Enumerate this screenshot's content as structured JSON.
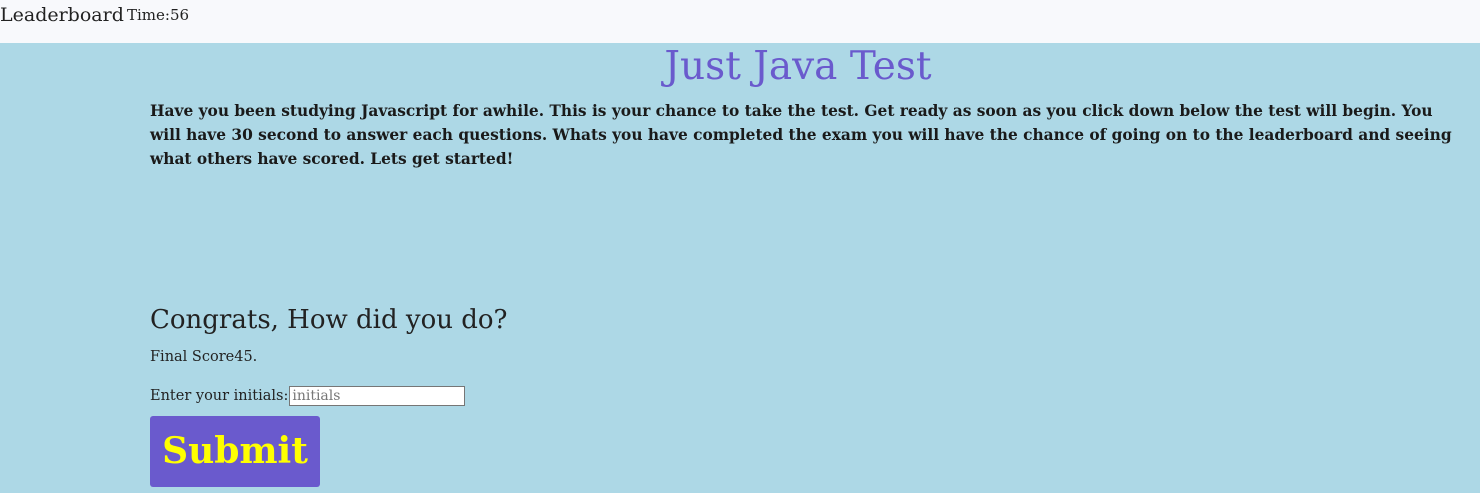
{
  "nav": {
    "leaderboard_label": "Leaderboard",
    "timer_text": "Time:56"
  },
  "main": {
    "title": "Just Java Test",
    "intro": "Have you been studying Javascript for awhile. This is your chance to take the test. Get ready as soon as you click down below the test will begin. You will have 30 second to answer each questions. Whats you have completed the exam you will have the chance of going on to the leaderboard and seeing what others have scored. Lets get started!"
  },
  "results": {
    "heading": "Congrats, How did you do?",
    "final_score_text": "Final Score45.",
    "initials_label": "Enter your initials:",
    "initials_value": "",
    "initials_placeholder": "initials",
    "submit_label": "Submit"
  },
  "colors": {
    "background": "#add8e6",
    "topbar": "#f8f9fc",
    "title": "#6a5acd",
    "button_bg": "#6a5acd",
    "button_text": "#ffff00"
  }
}
